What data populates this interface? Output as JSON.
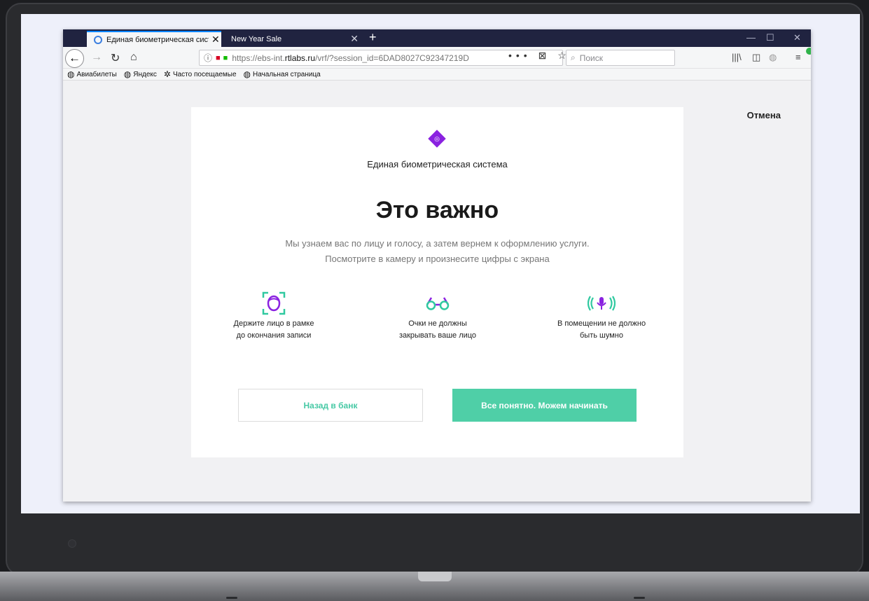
{
  "browser": {
    "active_tab_title": "Единая биометрическая систе",
    "inactive_tab_title": "New Year Sale",
    "url_prefix": "https://ebs-int.",
    "url_domain": "rtlabs.ru",
    "url_path": "/vrf/?session_id=6DAD8027C92347219D",
    "search_placeholder": "Поиск",
    "url_actions": "••• ⊠ ☆",
    "bookmarks": [
      "Авиабилеты",
      "Яндекс",
      "Часто посещаемые",
      "Начальная страница"
    ]
  },
  "page": {
    "cancel_label": "Отмена",
    "system_name": "Единая биометрическая система",
    "heading": "Это важно",
    "subtitle_line1": "Мы узнаем вас по лицу и голосу, а затем вернем к оформлению услуги.",
    "subtitle_line2": "Посмотрите в камеру и произнесите цифры с экрана",
    "tips": [
      {
        "icon": "face-frame-icon",
        "line1": "Держите лицо в рамке",
        "line2": "до окончания записи"
      },
      {
        "icon": "glasses-icon",
        "line1": "Очки не должны",
        "line2": "закрывать ваше лицо"
      },
      {
        "icon": "microphone-icon",
        "line1": "В помещении не должно",
        "line2": "быть шумно"
      }
    ],
    "back_button": "Назад в банк",
    "start_button": "Все понятно. Можем начинать"
  },
  "colors": {
    "accent_green": "#4fcfa7",
    "brand_purple": "#8a22e0",
    "tab_bar": "#202340"
  }
}
